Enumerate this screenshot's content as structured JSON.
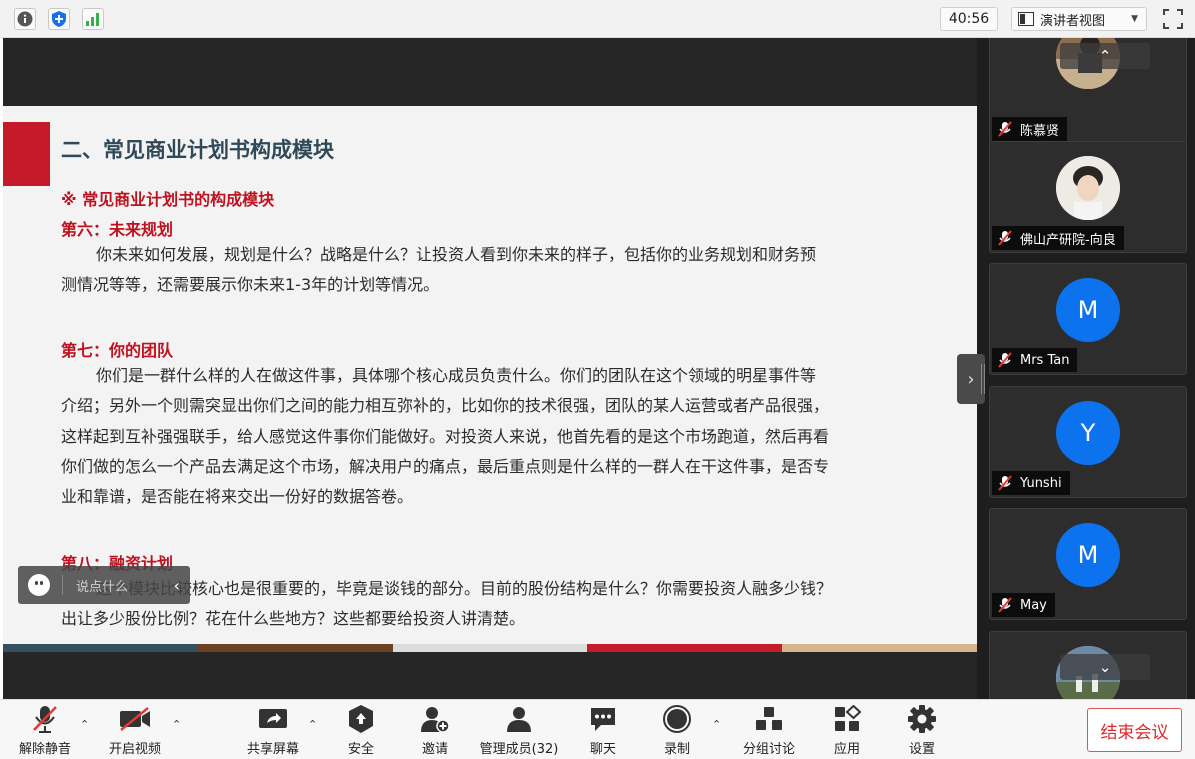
{
  "topbar": {
    "timer": "40:56",
    "view_mode": "演讲者视图",
    "icons": [
      "info-icon",
      "shield-icon",
      "signal-icon",
      "fullscreen-icon"
    ]
  },
  "slide": {
    "title": "二、常见商业计划书构成模块",
    "section_heading": "※  常见商业计划书的构成模块",
    "sec6_title": "第六：未来规划",
    "sec6_line1": "你未来如何发展，规划是什么？战略是什么？让投资人看到你未来的样子，包括你的业务规划和财务预",
    "sec6_line2": "测情况等等，还需要展示你未来1-3年的计划等情况。",
    "sec7_title": "第七：你的团队",
    "sec7_line1": "你们是一群什么样的人在做这件事，具体哪个核心成员负责什么。你们的团队在这个领域的明星事件等",
    "sec7_line2": "介绍；另外一个则需突显出你们之间的能力相互弥补的，比如你的技术很强，团队的某人运营或者产品很强，",
    "sec7_line3": "这样起到互补强强联手，给人感觉这件事你们能做好。对投资人来说，他首先看的是这个市场跑道，然后再看",
    "sec7_line4": "你们做的怎么一个产品去满足这个市场，解决用户的痛点，最后重点则是什么样的一群人在干这件事，是否专",
    "sec7_line5": "业和靠谱，是否能在将来交出一份好的数据答卷。",
    "sec8_title": "第八：融资计划",
    "sec8_line1": "这个模块比较核心也是很重要的，毕竟是谈钱的部分。目前的股份结构是什么？你需要投资人融多少钱？",
    "sec8_line2": "出让多少股份比例？花在什么些地方？这些都要给投资人讲清楚。",
    "color_bar": [
      "#34505f",
      "#6b4322",
      "#dcdcdc",
      "#c41a2a",
      "#d8b48e"
    ]
  },
  "chat": {
    "placeholder": "说点什么"
  },
  "participants": [
    {
      "name": "陈慕贤",
      "avatar_type": "photo",
      "initial": ""
    },
    {
      "name": "佛山产研院-向良",
      "avatar_type": "photo",
      "initial": ""
    },
    {
      "name": "Mrs Tan",
      "avatar_type": "initial",
      "initial": "M"
    },
    {
      "name": "Yunshi",
      "avatar_type": "initial",
      "initial": "Y"
    },
    {
      "name": "May",
      "avatar_type": "initial",
      "initial": "M"
    }
  ],
  "toolbar": {
    "unmute": "解除静音",
    "start_video": "开启视频",
    "share_screen": "共享屏幕",
    "security": "安全",
    "invite": "邀请",
    "manage_members": "管理成员(32)",
    "chat": "聊天",
    "record": "录制",
    "breakout": "分组讨论",
    "apps": "应用",
    "settings": "设置",
    "end_meeting": "结束会议"
  },
  "colors": {
    "accent_blue": "#0d72ee",
    "end_red": "#e0282e",
    "slide_red": "#c0111f"
  }
}
